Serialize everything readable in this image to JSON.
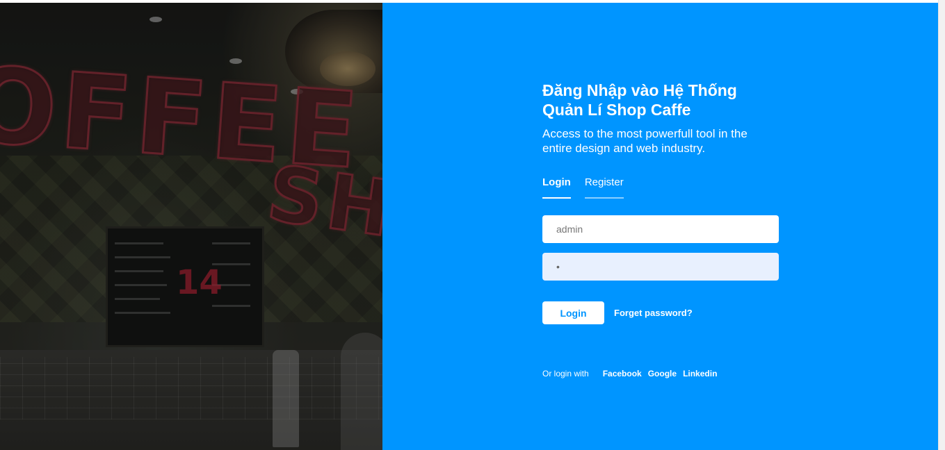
{
  "login": {
    "heading": "Đăng Nhập vào Hệ Thống Quản Lí Shop Caffe",
    "subheading": "Access to the most powerfull tool in the entire design and web industry.",
    "tabs": [
      {
        "label": "Login",
        "active": true
      },
      {
        "label": "Register",
        "active": false
      }
    ],
    "username_value": "admin",
    "password_value": "•",
    "login_button": "Login",
    "forget_link": "Forget password?",
    "social": {
      "prefix": "Or login with",
      "providers": [
        "Facebook",
        "Google",
        "Linkedin"
      ]
    }
  },
  "colors": {
    "panel_bg": "#0095ff",
    "button_text": "#0095ff",
    "password_bg": "#e8f0fe"
  },
  "photo": {
    "neon_coffee": "OFFEE",
    "neon_shop": "SHOP",
    "board_number": "14"
  }
}
